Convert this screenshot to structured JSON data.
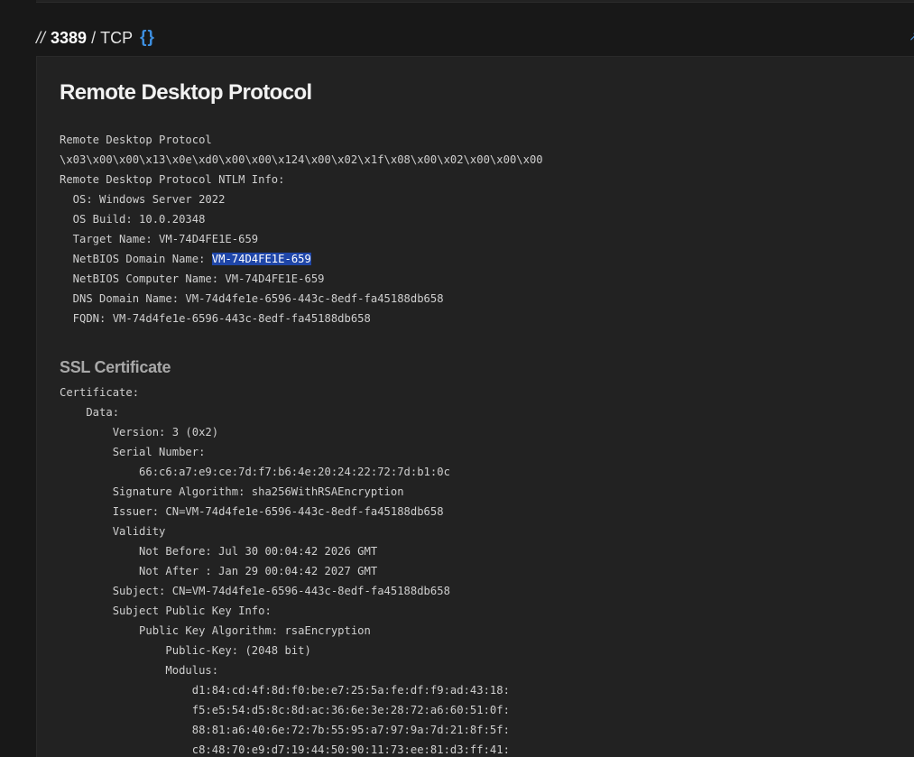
{
  "header": {
    "prefix": "//",
    "port": "3389",
    "separator": "/",
    "protocol": "TCP",
    "braces_icon_text": "{}",
    "corner_glyph": "↗"
  },
  "service": {
    "title": "Remote Desktop Protocol",
    "banner_lines": [
      "Remote Desktop Protocol",
      "\\x03\\x00\\x00\\x13\\x0e\\xd0\\x00\\x00\\x124\\x00\\x02\\x1f\\x08\\x00\\x02\\x00\\x00\\x00",
      "Remote Desktop Protocol NTLM Info:",
      "  OS: Windows Server 2022",
      "  OS Build: 10.0.20348",
      "  Target Name: VM-74D4FE1E-659"
    ],
    "netbios_domain_label": "  NetBIOS Domain Name: ",
    "netbios_domain_value": "VM-74D4FE1E-659",
    "banner_lines_after": [
      "  NetBIOS Computer Name: VM-74D4FE1E-659",
      "  DNS Domain Name: VM-74d4fe1e-6596-443c-8edf-fa45188db658",
      "  FQDN: VM-74d4fe1e-6596-443c-8edf-fa45188db658"
    ]
  },
  "ssl": {
    "title": "SSL Certificate",
    "lines": [
      "Certificate:",
      "    Data:",
      "        Version: 3 (0x2)",
      "        Serial Number:",
      "            66:c6:a7:e9:ce:7d:f7:b6:4e:20:24:22:72:7d:b1:0c",
      "        Signature Algorithm: sha256WithRSAEncryption",
      "        Issuer: CN=VM-74d4fe1e-6596-443c-8edf-fa45188db658",
      "        Validity",
      "            Not Before: Jul 30 00:04:42 2026 GMT",
      "            Not After : Jan 29 00:04:42 2027 GMT",
      "        Subject: CN=VM-74d4fe1e-6596-443c-8edf-fa45188db658",
      "        Subject Public Key Info:",
      "            Public Key Algorithm: rsaEncryption",
      "                Public-Key: (2048 bit)",
      "                Modulus:",
      "                    d1:84:cd:4f:8d:f0:be:e7:25:5a:fe:df:f9:ad:43:18:",
      "                    f5:e5:54:d5:8c:8d:ac:36:6e:3e:28:72:a6:60:51:0f:",
      "                    88:81:a6:40:6e:72:7b:55:95:a7:97:9a:7d:21:8f:5f:",
      "                    c8:48:70:e9:d7:19:44:50:90:11:73:ee:81:d3:ff:41:"
    ]
  },
  "colors": {
    "background": "#181818",
    "card": "#222222",
    "accent": "#3d8fe0",
    "selection": "#1f46a8"
  }
}
